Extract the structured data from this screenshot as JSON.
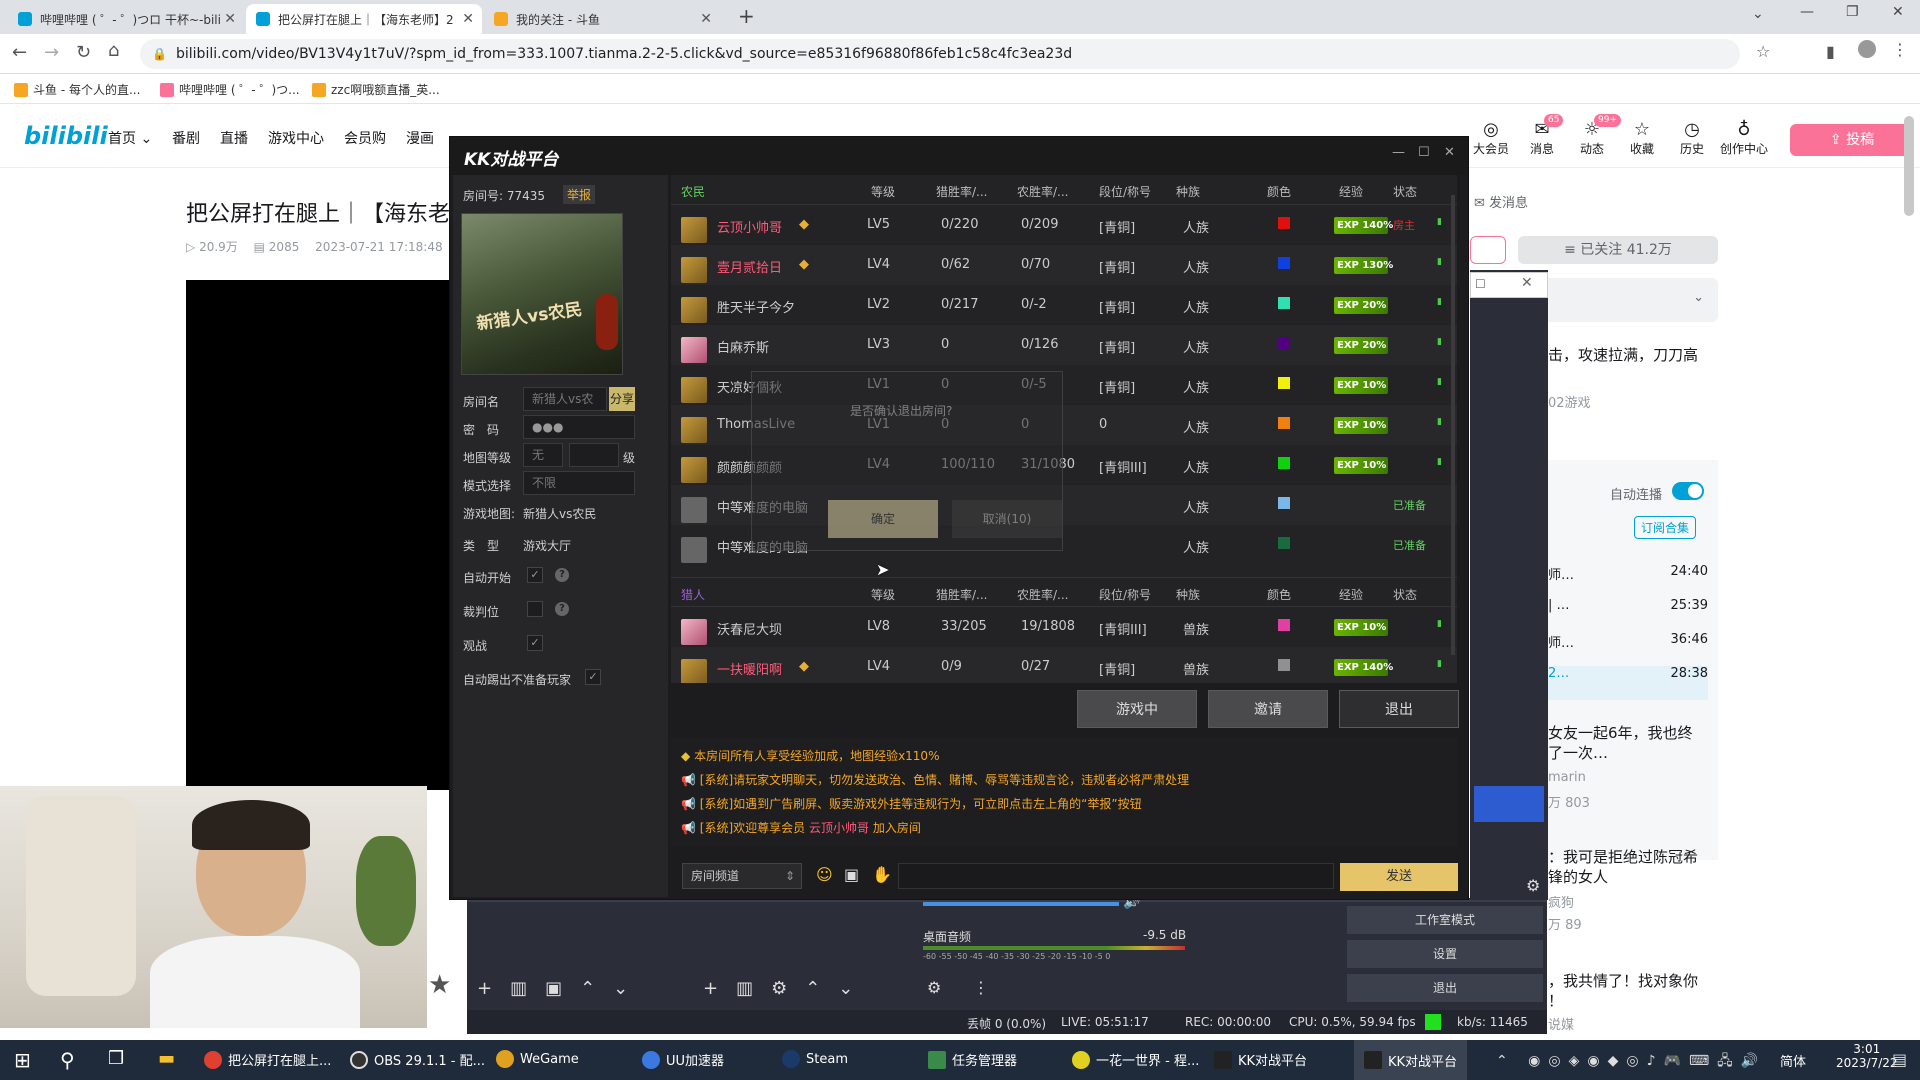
{
  "browser": {
    "tabs": [
      {
        "label": "哔哩哔哩 ( ゜- ゜)つロ 干杯~-bili"
      },
      {
        "label": "把公屏打在腿上｜【海东老师】2"
      },
      {
        "label": "我的关注 - 斗鱼"
      }
    ],
    "url": "bilibili.com/video/BV13V4y1t7uV/?spm_id_from=333.1007.tianma.2-2-5.click&vd_source=e85316f96880f86feb1c58c4fc3ea23d",
    "bookmarks": [
      "斗鱼 - 每个人的直...",
      "哔哩哔哩 ( ゜- ゜)つ...",
      "zzc啊哦额直播_英..."
    ]
  },
  "bili": {
    "logo": "bilibili",
    "nav": [
      "首页",
      "番剧",
      "直播",
      "游戏中心",
      "会员购",
      "漫画"
    ],
    "top_icons": [
      {
        "label": "大会员",
        "icon": "vip-icon"
      },
      {
        "label": "消息",
        "badge": "65",
        "icon": "message-icon"
      },
      {
        "label": "动态",
        "badge": "99+",
        "icon": "wind-icon"
      },
      {
        "label": "收藏",
        "icon": "star-icon"
      },
      {
        "label": "历史",
        "icon": "clock-icon"
      },
      {
        "label": "创作中心",
        "icon": "bulb-icon"
      }
    ],
    "upload_label": "投稿",
    "video_title": "把公屏打在腿上｜【海东老",
    "views": "20.9万",
    "danmaku": "2085",
    "date": "2023-07-21 17:18:48",
    "send_msg": "发消息",
    "followed": "已关注 41.2万",
    "right_texts": {
      "t1": "击，攻速拉满，刀刀高",
      "t2": "02游戏",
      "autoplay": "自动连播",
      "subscribe": "订阅合集",
      "playlist": [
        {
          "title": "师…",
          "dur": "24:40"
        },
        {
          "title": "| …",
          "dur": "25:39"
        },
        {
          "title": "师…",
          "dur": "36:46"
        },
        {
          "title": "2…",
          "dur": "28:38"
        }
      ],
      "r1": "女友一起6年，我也终",
      "r1b": "了一次…",
      "r1c": "marin",
      "r1d": "万  803",
      "r2": "：我可是拒绝过陈冠希",
      "r2b": "锋的女人",
      "r2c": "疯狗",
      "r2d": "万  89",
      "r3": "，我共情了！找对象你",
      "r3b": "！",
      "r3c": "说媒"
    }
  },
  "kk": {
    "title": "KK对战平台",
    "room_no_label": "房间号:",
    "room_no": "77435",
    "report": "举报",
    "map_art_text": "新猎人vs农民",
    "fields": {
      "room_name_label": "房间名",
      "room_name_placeholder": "新猎人vs农",
      "share": "分享",
      "password_label": "密　码",
      "password_value": "●●●",
      "map_level_label": "地图等级",
      "map_level_value": "无",
      "level_suffix": "级",
      "mode_label": "模式选择",
      "mode_value": "不限",
      "game_map_label": "游戏地图:",
      "game_map_value": "新猎人vs农民",
      "type_label": "类　型",
      "type_value": "游戏大厅",
      "auto_start": "自动开始",
      "referee": "裁判位",
      "spectate": "观战",
      "auto_kick": "自动踢出不准备玩家"
    },
    "headers": {
      "farmer": "农民",
      "hunter": "猎人",
      "level": "等级",
      "hunter_rate": "猎胜率/...",
      "farmer_rate": "农胜率/...",
      "rank": "段位/称号",
      "race": "种族",
      "color": "颜色",
      "exp": "经验",
      "status": "状态"
    },
    "farmers": [
      {
        "name": "云顶小帅哥",
        "vip": true,
        "level": "LV5",
        "hr": "0/220",
        "fr": "0/209",
        "rank": "[青铜]",
        "race": "人族",
        "color": "#e01010",
        "exp": "EXP 140%",
        "status": "房主",
        "avatar": "gold"
      },
      {
        "name": "壹月贰拾日",
        "vip": true,
        "level": "LV4",
        "hr": "0/62",
        "fr": "0/70",
        "rank": "[青铜]",
        "race": "人族",
        "color": "#1040e0",
        "exp": "EXP 130%",
        "status": "",
        "avatar": "gold"
      },
      {
        "name": "胜天半子今夕",
        "vip": false,
        "level": "LV2",
        "hr": "0/217",
        "fr": "0/-2",
        "rank": "[青铜]",
        "race": "人族",
        "color": "#30e0b0",
        "exp": "EXP 20%",
        "status": "",
        "avatar": "gold"
      },
      {
        "name": "白麻乔斯",
        "vip": false,
        "level": "LV3",
        "hr": "0",
        "fr": "0/126",
        "rank": "[青铜]",
        "race": "人族",
        "color": "#500080",
        "exp": "EXP 20%",
        "status": "",
        "avatar": "pink"
      },
      {
        "name": "天凉好個秋",
        "vip": false,
        "level": "LV1",
        "hr": "0",
        "fr": "0/-5",
        "rank": "[青铜]",
        "race": "人族",
        "color": "#f0f010",
        "exp": "EXP 10%",
        "status": "",
        "avatar": "gold"
      },
      {
        "name": "ThomasLive",
        "vip": false,
        "level": "LV1",
        "hr": "0",
        "fr": "0",
        "rank": "0",
        "race": "人族",
        "color": "#f08010",
        "exp": "EXP 10%",
        "status": "",
        "avatar": "gold"
      },
      {
        "name": "颜颜颜颜颜",
        "vip": false,
        "level": "LV4",
        "hr": "100/110",
        "fr": "31/1080",
        "rank": "[青铜III]",
        "race": "人族",
        "color": "#10d010",
        "exp": "EXP 10%",
        "status": "",
        "avatar": "gold"
      },
      {
        "name": "中等难度的电脑",
        "vip": false,
        "level": "",
        "hr": "",
        "fr": "",
        "rank": "",
        "race": "人族",
        "color": "#7ab8e8",
        "exp": "",
        "status": "已准备",
        "avatar": "gray"
      },
      {
        "name": "中等难度的电脑",
        "vip": false,
        "level": "",
        "hr": "",
        "fr": "",
        "rank": "",
        "race": "人族",
        "color": "#1a6a40",
        "exp": "",
        "status": "已准备",
        "avatar": "gray"
      }
    ],
    "hunters": [
      {
        "name": "沃春尼大坝",
        "vip": false,
        "level": "LV8",
        "hr": "33/205",
        "fr": "19/1808",
        "rank": "[青铜III]",
        "race": "兽族",
        "color": "#e040a0",
        "exp": "EXP 10%",
        "status": "",
        "avatar": "pink"
      },
      {
        "name": "一扶暖阳啊",
        "vip": true,
        "level": "LV4",
        "hr": "0/9",
        "fr": "0/27",
        "rank": "[青铜]",
        "race": "兽族",
        "color": "#909090",
        "exp": "EXP 140%",
        "status": "",
        "avatar": "gold"
      }
    ],
    "dialog": {
      "question": "是否确认退出房间?",
      "confirm": "确定",
      "cancel": "取消(10)"
    },
    "buttons": {
      "in_game": "游戏中",
      "invite": "邀请",
      "exit": "退出"
    },
    "messages": [
      {
        "prefix": "",
        "text": "本房间所有人享受经验加成，地图经验x110%"
      },
      {
        "prefix": "[系统]",
        "text": "请玩家文明聊天，切勿发送政治、色情、赌博、辱骂等违规言论，违规者必将严肃处理"
      },
      {
        "prefix": "[系统]",
        "text": "如遇到广告刷屏、贩卖游戏外挂等违规行为，可立即点击左上角的“举报”按钮"
      },
      {
        "prefix": "[系统]",
        "text": "欢迎尊享会员 ",
        "highlight": "云顶小帅哥",
        "suffix": " 加入房间"
      }
    ],
    "channel": "房间频道",
    "send": "发送"
  },
  "obs": {
    "audio_name": "桌面音频",
    "audio_db": "-9.5 dB",
    "meter_ticks": "-60 -55 -50 -45 -40 -35 -30 -25 -20 -15 -10 -5 0",
    "studio_mode": "工作室模式",
    "settings": "设置",
    "exit": "退出",
    "status": {
      "dropped": "丢帧 0 (0.0%)",
      "live": "LIVE: 05:51:17",
      "rec": "REC: 00:00:00",
      "cpu": "CPU: 0.5%, 59.94 fps",
      "kbs": "kb/s: 11465"
    }
  },
  "taskbar": {
    "apps": [
      {
        "label": "把公屏打在腿上..."
      },
      {
        "label": "OBS 29.1.1 - 配..."
      },
      {
        "label": "WeGame"
      },
      {
        "label": "UU加速器"
      },
      {
        "label": "Steam"
      },
      {
        "label": "任务管理器"
      },
      {
        "label": "一花一世界 - 程..."
      },
      {
        "label": "KK对战平台"
      },
      {
        "label": "KK对战平台"
      }
    ],
    "ime": "简体",
    "time": "3:01",
    "date": "2023/7/22"
  }
}
